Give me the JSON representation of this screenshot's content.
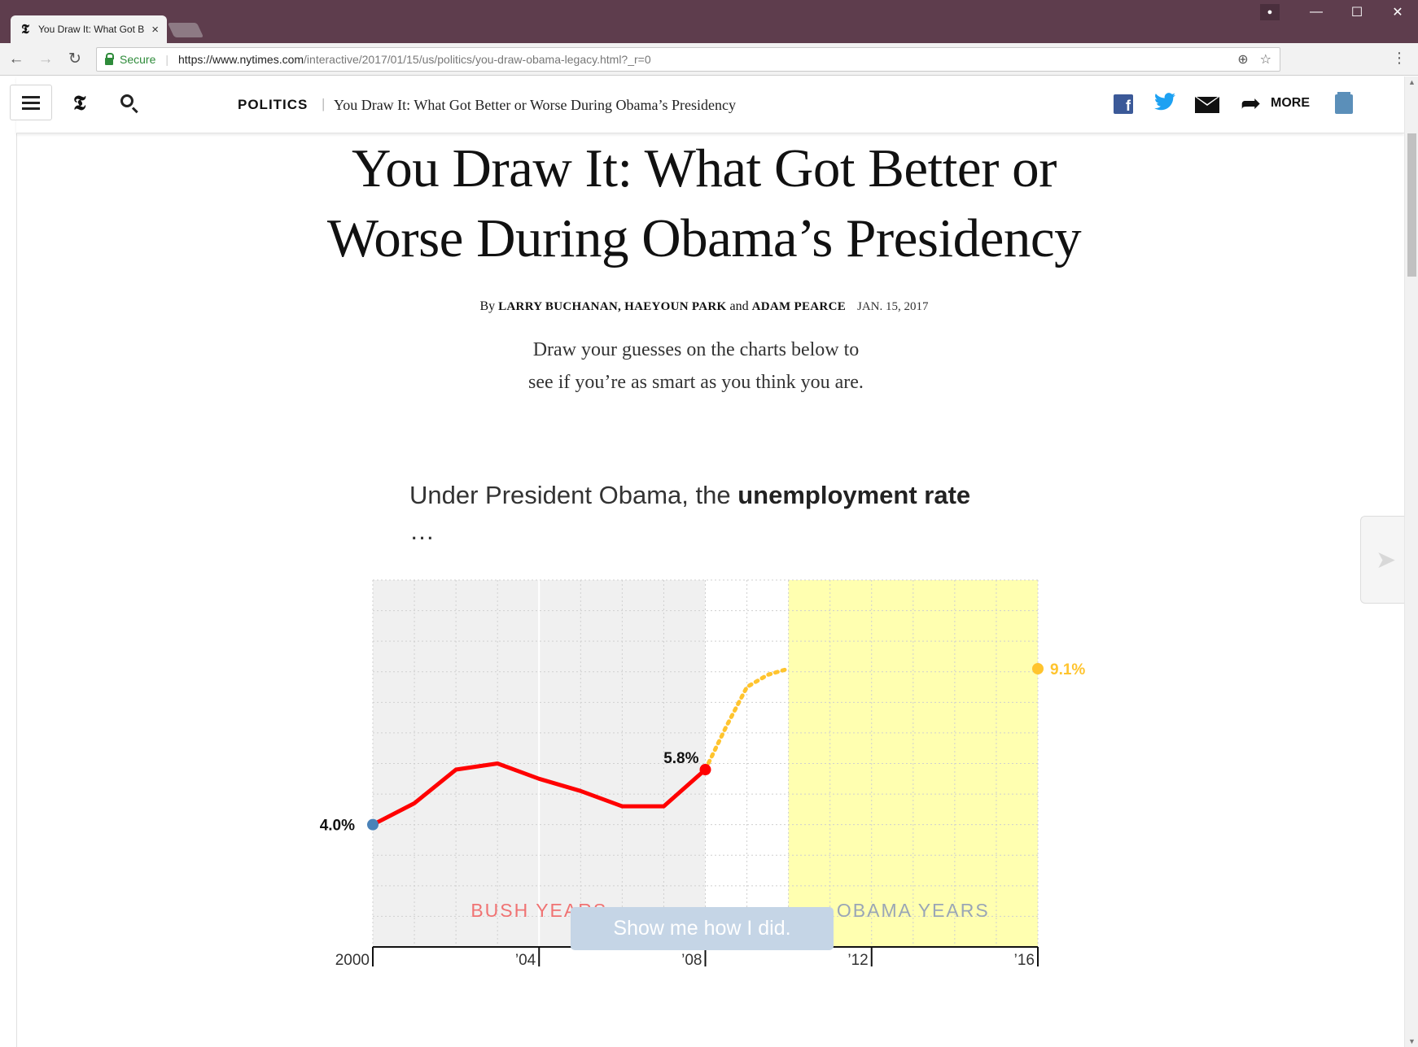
{
  "browser": {
    "tab_title": "You Draw It: What Got B",
    "tab_close": "×",
    "tab_favicon": "𝕿",
    "window_user_icon": "person-icon",
    "minimize": "—",
    "maximize": "☐",
    "close": "✕",
    "secure_label": "Secure",
    "url_main": "https://www.nytimes.com",
    "url_rest": "/interactive/2017/01/15/us/politics/you-draw-obama-legacy.html?_r=0"
  },
  "header": {
    "logo": "𝕿",
    "section": "POLITICS",
    "section_separator": "|",
    "headline": "You Draw It: What Got Better or Worse During Obama’s Presidency",
    "more_label": "MORE"
  },
  "article": {
    "headline_line1": "You Draw It: What Got Better or",
    "headline_line2": "Worse During Obama’s Presidency",
    "byline_by": "By ",
    "author1": "LARRY BUCHANAN",
    "author_sep1": ", ",
    "author2": "HAEYOUN PARK",
    "author_and": " and ",
    "author3": "ADAM PEARCE",
    "date": "JAN. 15, 2017",
    "intro_line1": "Draw your guesses on the charts below to",
    "intro_line2": "see if you’re as smart as you think you are."
  },
  "question": {
    "prefix": "Under President Obama, the ",
    "bold": "unemployment rate",
    "suffix": " …"
  },
  "chart_data": {
    "type": "line",
    "title": "Under President Obama, the unemployment rate …",
    "xlim": [
      2000,
      2016
    ],
    "ylim": [
      0,
      12
    ],
    "x_tick_labels": [
      {
        "x": 2000,
        "label": "2000"
      },
      {
        "x": 2004,
        "label": "’04"
      },
      {
        "x": 2008,
        "label": "’08"
      },
      {
        "x": 2012,
        "label": "’12"
      },
      {
        "x": 2016,
        "label": "’16"
      }
    ],
    "series": [
      {
        "role": "actual",
        "color": "#ff0000",
        "x": [
          2000,
          2001,
          2002,
          2003,
          2004,
          2005,
          2006,
          2007,
          2008
        ],
        "y": [
          4.0,
          4.7,
          5.8,
          6.0,
          5.5,
          5.1,
          4.6,
          4.6,
          5.8
        ]
      },
      {
        "role": "user-drawn-guess",
        "color": "#ffc42e",
        "style": "dotted",
        "x": [
          2008,
          2008.5,
          2009,
          2009.5,
          2010
        ],
        "y": [
          5.8,
          7.2,
          8.5,
          8.9,
          9.1
        ]
      }
    ],
    "labels": [
      {
        "x": 2000,
        "y": 4.0,
        "text": "4.0%",
        "color": "#111111"
      },
      {
        "x": 2008,
        "y": 5.8,
        "text": "5.8%",
        "color": "#111111"
      },
      {
        "x": 2016,
        "y": 9.1,
        "text": "9.1%",
        "color": "#ffc42e"
      }
    ],
    "regions": [
      {
        "name": "BUSH YEARS",
        "x_start": 2000,
        "x_end": 2008,
        "color": "#f0f0f0",
        "label_color": "#f07373"
      },
      {
        "name": "OBAMA YEARS",
        "x_start": 2010,
        "x_end": 2016,
        "color": "#ffffb0",
        "label_color": "#9aa6b6"
      }
    ],
    "grid": true,
    "start_point_color": "#4a82b8",
    "end_point_color": "#ff0000",
    "guess_end_color": "#ffc42e"
  },
  "button": {
    "label": "Show me how I did."
  },
  "icons": {
    "fb": "f",
    "twitter": "🐦",
    "more_arrow": "➦",
    "next_arrow": "➤"
  }
}
